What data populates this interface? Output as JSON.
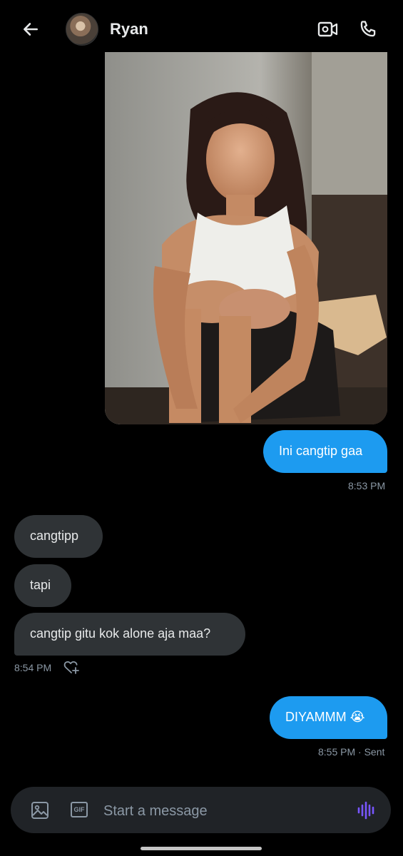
{
  "header": {
    "contact_name": "Ryan",
    "back_icon": "arrow-left-icon",
    "video_icon": "video-call-icon",
    "phone_icon": "phone-icon"
  },
  "messages": {
    "sent_1": {
      "text": "Ini cangtip gaa",
      "time": "8:53 PM"
    },
    "received": [
      {
        "text": "cangtipp"
      },
      {
        "text": "tapi"
      },
      {
        "text": "cangtip gitu kok alone aja maa?"
      }
    ],
    "received_time": "8:54 PM",
    "sent_2": {
      "text": "DIYAMMM 😭",
      "status": "8:55 PM · Sent"
    }
  },
  "composer": {
    "placeholder": "Start a message",
    "gif_label": "GIF",
    "media_icon": "image-icon",
    "voice_icon": "voice-wave-icon"
  },
  "colors": {
    "background": "#000000",
    "sent_bubble": "#1d9bf0",
    "received_bubble": "#2f3336",
    "meta_text": "#8b98a5",
    "voice_accent": "#7856ff"
  }
}
